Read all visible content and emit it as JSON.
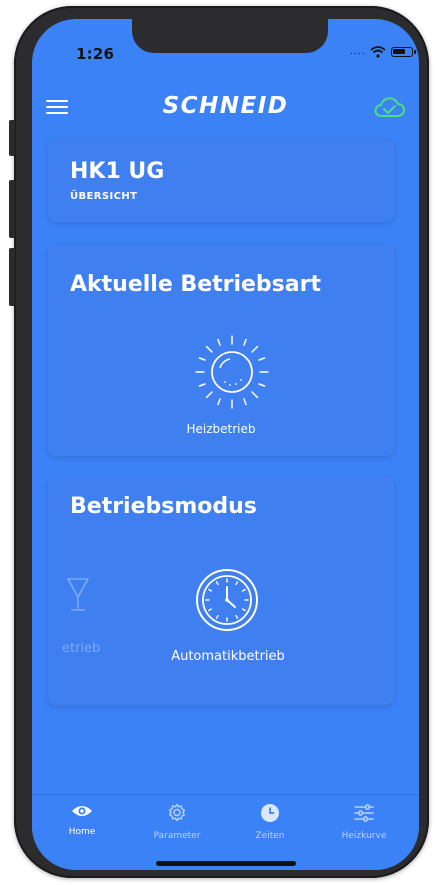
{
  "status_bar": {
    "time": "1:26"
  },
  "header": {
    "brand": "SCHNEID"
  },
  "overview_card": {
    "title": "HK1 UG",
    "subtitle": "ÜBERSICHT"
  },
  "operating_mode_card": {
    "title": "Aktuelle Betriebsart",
    "mode_label": "Heizbetrieb"
  },
  "operation_card": {
    "title": "Betriebsmodus",
    "selected_label": "Automatikbetrieb",
    "previous_label_fragment": "etrieb"
  },
  "tabs": [
    {
      "label": "Home",
      "icon": "eye-icon",
      "active": true
    },
    {
      "label": "Parameter",
      "icon": "gear-icon",
      "active": false
    },
    {
      "label": "Zeiten",
      "icon": "clock-icon",
      "active": false
    },
    {
      "label": "Heizkurve",
      "icon": "sliders-icon",
      "active": false
    }
  ],
  "colors": {
    "background": "#3b82f6",
    "card": "#3f7ff0",
    "text": "#ffffff",
    "cloud_status": "#4ade80",
    "tab_inactive": "#bcd2fb"
  }
}
